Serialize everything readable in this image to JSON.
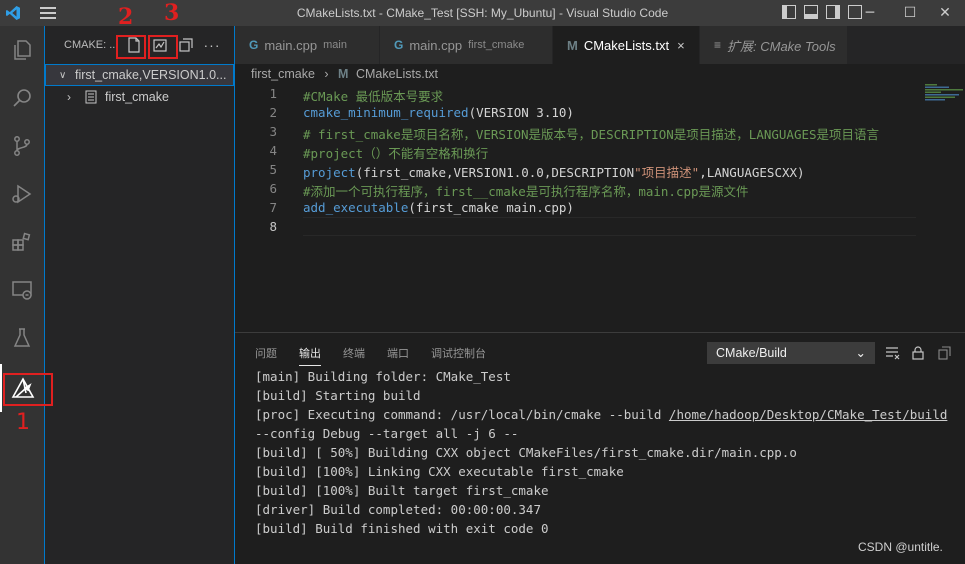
{
  "window": {
    "title": "CMakeLists.txt - CMake_Test [SSH: My_Ubuntu] - Visual Studio Code"
  },
  "sidebar": {
    "header": "CMAKE: ...",
    "tree": [
      {
        "label": "first_cmake,VERSION1.0...",
        "expanded": true
      },
      {
        "label": "first_cmake",
        "expanded": false
      }
    ]
  },
  "tabs": [
    {
      "label": "main.cpp",
      "desc": "main",
      "icon": "C++",
      "active": false
    },
    {
      "label": "main.cpp",
      "desc": "first_cmake",
      "icon": "C++",
      "active": false
    },
    {
      "label": "CMakeLists.txt",
      "desc": "",
      "icon": "M",
      "active": true,
      "close": "×"
    },
    {
      "label": "扩展: CMake Tools",
      "desc": "",
      "icon": "≡",
      "active": false
    }
  ],
  "breadcrumb": {
    "folder": "first_cmake",
    "file": "CMakeLists.txt"
  },
  "editor": {
    "lines": [
      {
        "n": "1",
        "parts": [
          {
            "t": "#CMake 最低版本号要求",
            "c": "c-comment"
          }
        ]
      },
      {
        "n": "2",
        "parts": [
          {
            "t": "cmake_minimum_required",
            "c": "c-func"
          },
          {
            "t": "(VERSION 3.10)",
            "c": "c-txt"
          }
        ]
      },
      {
        "n": "3",
        "parts": [
          {
            "t": "# first_cmake是项目名称，VERSION是版本号，DESCRIPTION是项目描述，LANGUAGES是项目语言",
            "c": "c-comment"
          }
        ]
      },
      {
        "n": "4",
        "parts": [
          {
            "t": "#project（）不能有空格和换行",
            "c": "c-comment"
          }
        ]
      },
      {
        "n": "5",
        "parts": [
          {
            "t": "project",
            "c": "c-func"
          },
          {
            "t": "(first_cmake,VERSION1.0.0,DESCRIPTION",
            "c": "c-txt"
          },
          {
            "t": "\"项目描述\"",
            "c": "c-str"
          },
          {
            "t": ",LANGUAGESCXX)",
            "c": "c-txt"
          }
        ]
      },
      {
        "n": "6",
        "parts": [
          {
            "t": "#添加一个可执行程序，first__cmake是可执行程序名称，main.cpp是源文件",
            "c": "c-comment"
          }
        ]
      },
      {
        "n": "7",
        "parts": [
          {
            "t": "add_executable",
            "c": "c-func"
          },
          {
            "t": "(first_cmake main.cpp)",
            "c": "c-txt"
          }
        ]
      },
      {
        "n": "8",
        "parts": []
      }
    ]
  },
  "panel": {
    "tabs": [
      "问题",
      "输出",
      "终端",
      "端口",
      "调试控制台"
    ],
    "active_tab": "输出",
    "select": "CMake/Build",
    "output": [
      "[main] Building folder: CMake_Test",
      "[build] Starting build",
      "[proc] Executing command: /usr/local/bin/cmake --build ",
      "--config Debug --target all -j 6 --",
      "[build] [ 50%] Building CXX object CMakeFiles/first_cmake.dir/main.cpp.o",
      "[build] [100%] Linking CXX executable first_cmake",
      "[build] [100%] Built target first_cmake",
      "[driver] Build completed: 00:00:00.347",
      "[build] Build finished with exit code 0"
    ],
    "output_link": "/home/hadoop/Desktop/CMake_Test/build"
  },
  "annotations": {
    "n1": "1",
    "n2": "2",
    "n3": "3"
  },
  "watermark": "CSDN @untitle.",
  "colors": {
    "accent": "#007acc",
    "annotation": "#e02020"
  }
}
